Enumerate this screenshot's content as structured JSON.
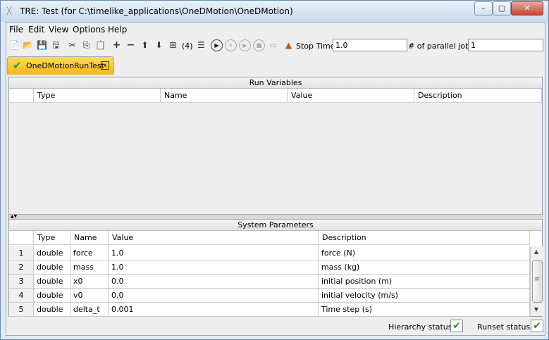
{
  "window": {
    "title": "TRE:  Test (for C:\\timelike_applications\\OneDMotion\\OneDMotion)",
    "minimize_label": "–",
    "maximize_label": "▢",
    "close_label": "✕"
  },
  "menu": [
    "File",
    "Edit",
    "View",
    "Options",
    "Help"
  ],
  "toolbar": {
    "icons": {
      "new": "📄",
      "open": "📂",
      "save": "💾",
      "save_all": "🖫",
      "cut": "✂",
      "copy": "⎘",
      "paste": "📋",
      "add": "+",
      "remove": "−",
      "up": "⬆",
      "down": "⬇",
      "hierarchy": "⊞",
      "list": "☰",
      "run": "▶",
      "pause": "⏸",
      "resume": "▶",
      "stop": "■",
      "terminal": "▭",
      "matlab": "▲"
    },
    "count_label": "(4)",
    "stop_time_label": "Stop Time:",
    "stop_time_value": "1.0",
    "parallel_jobs_label": "# of parallel jobs:",
    "parallel_jobs_value": "1"
  },
  "tab": {
    "label": "OneDMotionRunTest",
    "check_icon": "✔",
    "close_label": "x"
  },
  "run_variables": {
    "title": "Run Variables",
    "columns": [
      "Type",
      "Name",
      "Value",
      "Description"
    ]
  },
  "splitter_label": "▲▼",
  "system_parameters": {
    "title": "System Parameters",
    "columns": [
      "Type",
      "Name",
      "Value",
      "Description"
    ],
    "rows": [
      {
        "index": "1",
        "type": "double",
        "name": "force",
        "value": "1.0",
        "description": "force (N)"
      },
      {
        "index": "2",
        "type": "double",
        "name": "mass",
        "value": "1.0",
        "description": "mass (kg)"
      },
      {
        "index": "3",
        "type": "double",
        "name": "x0",
        "value": "0.0",
        "description": "initial position (m)"
      },
      {
        "index": "4",
        "type": "double",
        "name": "v0",
        "value": "0.0",
        "description": "initial velocity (m/s)"
      },
      {
        "index": "5",
        "type": "double",
        "name": "delta_t",
        "value": "0.001",
        "description": "Time step (s)"
      }
    ]
  },
  "scrollbar": {
    "up": "▲",
    "down": "▼",
    "grip": "≡"
  },
  "status": {
    "hierarchy_label": "Hierarchy status:",
    "runset_label": "Runset status:",
    "check": "✔"
  }
}
